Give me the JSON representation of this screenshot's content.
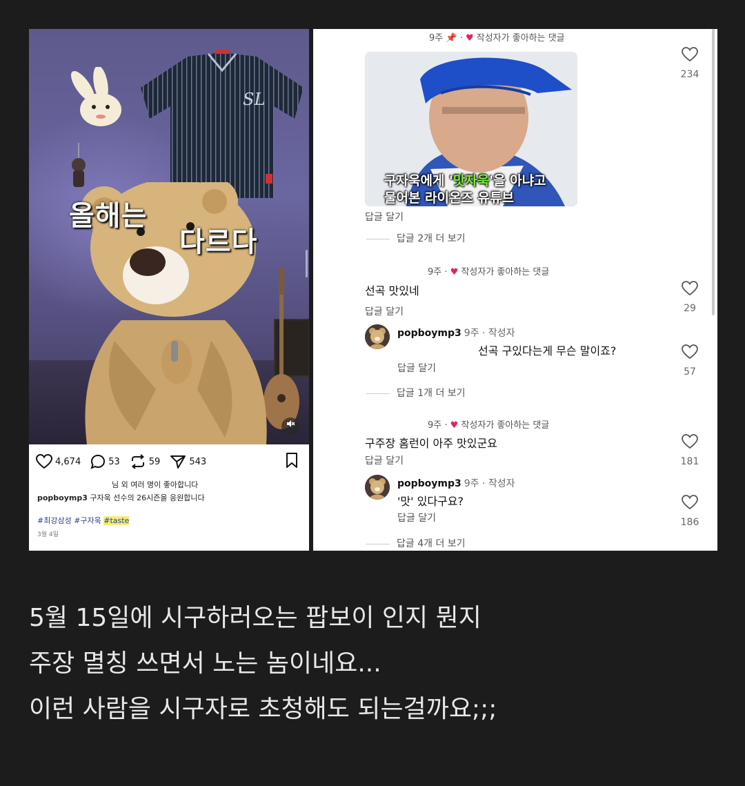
{
  "post": {
    "video_text_1": "올해는",
    "video_text_2": "다르다",
    "likes": "4,674",
    "comments": "53",
    "reposts": "59",
    "shares": "543",
    "liked_by": "님 외 여러 명이 좋아합니다",
    "username": "popboymp3",
    "caption": "구자욱 선수의 26시즌을 응원합니다",
    "tags": [
      "#최강삼성",
      "#구자욱",
      "#taste"
    ],
    "date": "3월 4일"
  },
  "comments": {
    "c1": {
      "meta_time": "9주",
      "meta_label": "작성자가 좋아하는 댓글",
      "thumb_line1_pre": "구자욱에게 '",
      "thumb_line1_green": "맛자욱",
      "thumb_line1_post": "'을 아냐고",
      "thumb_line2": "물어본 라이온즈 유튜브",
      "reply": "답글 달기",
      "more": "답글 2개 더 보기",
      "likes": "234"
    },
    "c2": {
      "meta_time": "9주",
      "meta_label": "작성자가 좋아하는 댓글",
      "text": "선곡 맛있네",
      "reply": "답글 달기",
      "likes": "29",
      "sub": {
        "username": "popboymp3",
        "meta": "9주 · 작성자",
        "text": "선곡 구있다는게 무슨 말이죠?",
        "reply": "답글 달기",
        "likes": "57"
      },
      "more": "답글 1개 더 보기"
    },
    "c3": {
      "meta_time": "9주",
      "meta_label": "작성자가 좋아하는 댓글",
      "text": "구주장 홈런이 아주 맛있군요",
      "reply": "답글 달기",
      "likes": "181",
      "sub": {
        "username": "popboymp3",
        "meta": "9주 · 작성자",
        "text": "'맛' 있다구요?",
        "reply": "답글 달기",
        "likes": "186"
      },
      "more": "답글 4개 더 보기"
    }
  },
  "story": {
    "line1": "5월 15일에 시구하러오는 팝보이 인지 뭔지",
    "line2": "주장 멸칭 쓰면서 노는 놈이네요...",
    "line3": "이런 사람을 시구자로 초청해도 되는걸까요;;;"
  }
}
